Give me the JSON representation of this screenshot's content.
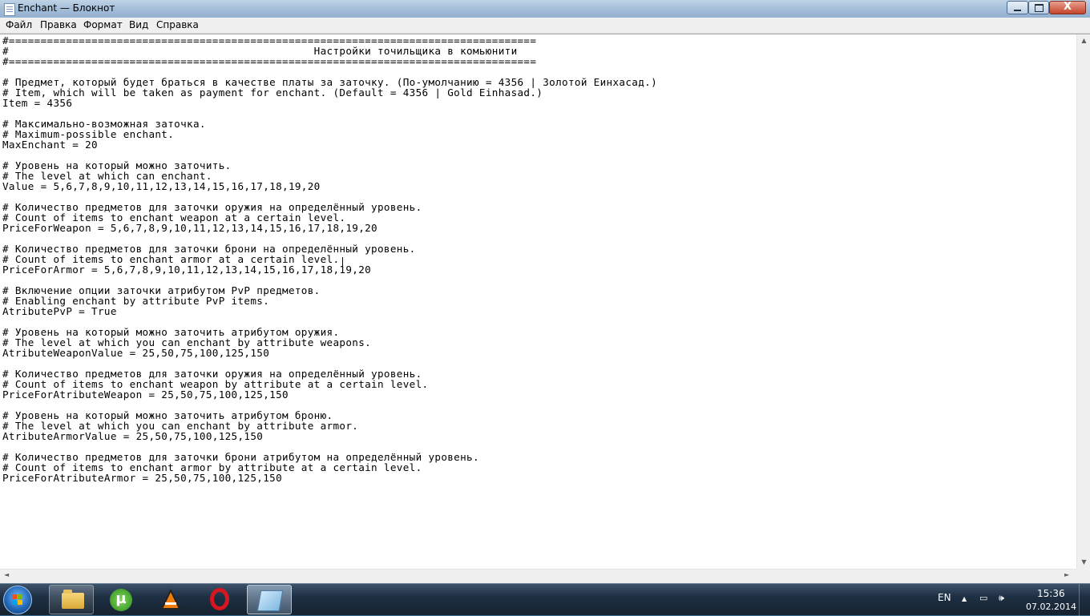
{
  "window": {
    "title": "Enchant — Блокнот",
    "close_glyph": "X"
  },
  "menu": [
    "Файл",
    "Правка",
    "Формат",
    "Вид",
    "Справка"
  ],
  "document": {
    "lines": [
      "#===================================================================================",
      "#                                                Настройки точильщика в комьюнити",
      "#===================================================================================",
      "",
      "# Предмет, который будет браться в качестве платы за заточку. (По-умолчанию = 4356 | Золотой Еинхасад.)",
      "# Item, which will be taken as payment for enchant. (Default = 4356 | Gold Einhasad.)",
      "Item = 4356",
      "",
      "# Максимально-возможная заточка.",
      "# Maximum-possible enchant.",
      "MaxEnchant = 20",
      "",
      "# Уровень на который можно заточить.",
      "# The level at which can enchant.",
      "Value = 5,6,7,8,9,10,11,12,13,14,15,16,17,18,19,20",
      "",
      "# Количество предметов для заточки оружия на определённый уровень.",
      "# Count of items to enchant weapon at a certain level.",
      "PriceForWeapon = 5,6,7,8,9,10,11,12,13,14,15,16,17,18,19,20",
      "",
      "# Количество предметов для заточки брони на определённый уровень.",
      "# Count of items to enchant armor at a certain level.",
      "PriceForArmor = 5,6,7,8,9,10,11,12,13,14,15,16,17,18,19,20",
      "",
      "# Включение опции заточки атрибутом PvP предметов.",
      "# Enabling enchant by attribute PvP items.",
      "AtributePvP = True",
      "",
      "# Уровень на который можно заточить атрибутом оружия.",
      "# The level at which you can enchant by attribute weapons.",
      "AtributeWeaponValue = 25,50,75,100,125,150",
      "",
      "# Количество предметов для заточки оружия на определённый уровень.",
      "# Count of items to enchant weapon by attribute at a certain level.",
      "PriceForAtributeWeapon = 25,50,75,100,125,150",
      "",
      "# Уровень на который можно заточить атрибутом броню.",
      "# The level at which you can enchant by attribute armor.",
      "AtributeArmorValue = 25,50,75,100,125,150",
      "",
      "# Количество предметов для заточки брони атрибутом на определённый уровень.",
      "# Count of items to enchant armor by attribute at a certain level.",
      "PriceForAtributeArmor = 25,50,75,100,125,150"
    ]
  },
  "scrollbars": {
    "up": "▲",
    "down": "▼",
    "left": "◄",
    "right": "►"
  },
  "taskbar": {
    "pinned": [
      "folder-icon",
      "utorrent-icon",
      "vlc-icon",
      "opera-icon"
    ],
    "active": "notepad-icon",
    "utorrent_glyph": "µ",
    "language": "EN",
    "tray": {
      "arrow": "▲",
      "network_glyph": "▭",
      "volume_glyph": "🕪"
    },
    "time": "15:36",
    "date": "07.02.2014"
  },
  "colors": {
    "titlebar": "#a6c0da",
    "close_button": "#c4442b",
    "taskbar": "#1f3044",
    "editor_bg": "#ffffff"
  }
}
